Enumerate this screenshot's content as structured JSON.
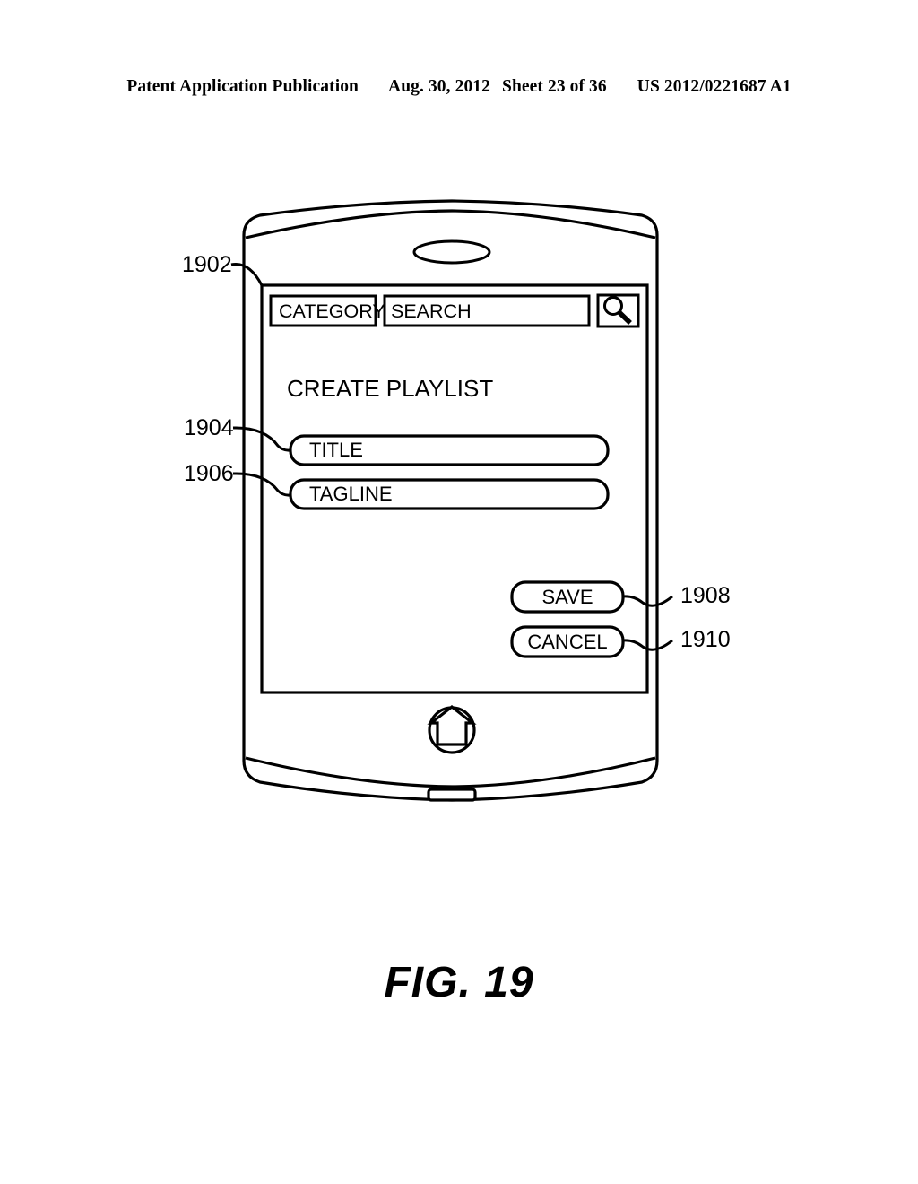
{
  "header": {
    "publication": "Patent Application Publication",
    "date": "Aug. 30, 2012",
    "sheet": "Sheet 23 of 36",
    "number": "US 2012/0221687 A1"
  },
  "figure": {
    "caption": "FIG. 19"
  },
  "device": {
    "name": "mobile-handset",
    "speaker_grille": "speaker-grille-ellipse",
    "home_button": "home-icon",
    "bottom_slot": "bottom-slot"
  },
  "screen": {
    "topbar": {
      "category_label": "CATEGORY",
      "search_placeholder": "SEARCH",
      "search_value": "",
      "search_icon": "magnifier-icon"
    },
    "heading": "CREATE PLAYLIST",
    "fields": [
      {
        "label": "TITLE",
        "value": "",
        "name": "title-field"
      },
      {
        "label": "TAGLINE",
        "value": "",
        "name": "tagline-field"
      }
    ],
    "buttons": [
      {
        "label": "SAVE",
        "name": "save-button"
      },
      {
        "label": "CANCEL",
        "name": "cancel-button"
      }
    ]
  },
  "reference_numerals": [
    {
      "id": "1902",
      "target": "screen-display-area"
    },
    {
      "id": "1904",
      "target": "title-field"
    },
    {
      "id": "1906",
      "target": "tagline-field"
    },
    {
      "id": "1908",
      "target": "save-button"
    },
    {
      "id": "1910",
      "target": "cancel-button"
    }
  ],
  "colors": {
    "ink": "#000000",
    "paper": "#ffffff"
  }
}
